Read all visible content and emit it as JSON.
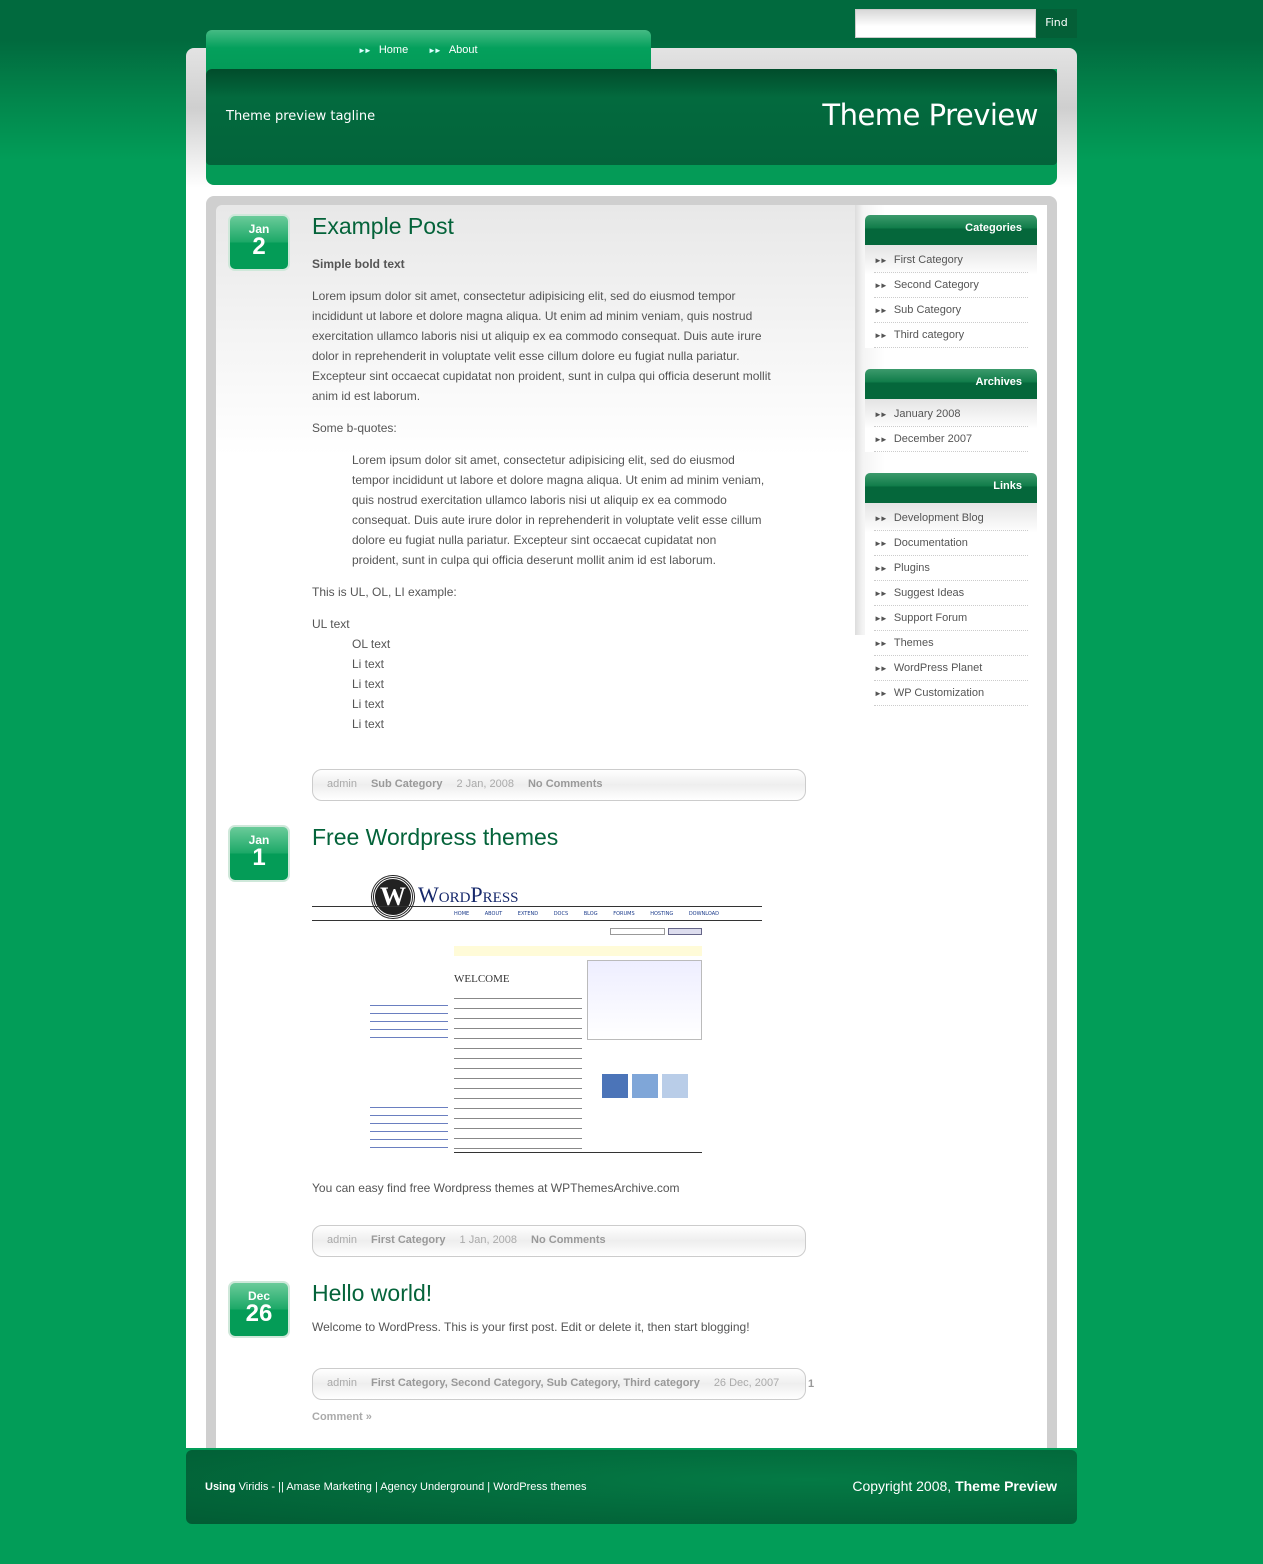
{
  "search": {
    "placeholder": "",
    "button": "Find"
  },
  "nav": [
    {
      "label": "Home"
    },
    {
      "label": "About"
    }
  ],
  "header": {
    "tagline": "Theme preview tagline",
    "title": "Theme Preview"
  },
  "posts": [
    {
      "month": "Jan",
      "day": "2",
      "title": "Example Post",
      "bold": "Simple bold text",
      "para": "Lorem ipsum dolor sit amet, consectetur adipisicing elit, sed do eiusmod tempor incididunt ut labore et dolore magna aliqua. Ut enim ad minim veniam, quis nostrud exercitation ullamco laboris nisi ut aliquip ex ea commodo consequat. Duis aute irure dolor in reprehenderit in voluptate velit esse cillum dolore eu fugiat nulla pariatur. Excepteur sint occaecat cupidatat non proident, sunt in culpa qui officia deserunt mollit anim id est laborum.",
      "bq_label": "Some b-quotes:",
      "blockquote": "Lorem ipsum dolor sit amet, consectetur adipisicing elit, sed do eiusmod tempor incididunt ut labore et dolore magna aliqua. Ut enim ad minim veniam, quis nostrud exercitation ullamco laboris nisi ut aliquip ex ea commodo consequat. Duis aute irure dolor in reprehenderit in voluptate velit esse cillum dolore eu fugiat nulla pariatur. Excepteur sint occaecat cupidatat non proident, sunt in culpa qui officia deserunt mollit anim id est laborum.",
      "list_label": "This is UL, OL, LI example:",
      "ul": "UL text",
      "ol": "OL text",
      "li": [
        "Li text",
        "Li text",
        "Li text",
        "Li text"
      ],
      "author": "admin",
      "category": "Sub Category",
      "date": "2 Jan, 2008",
      "comments": "No Comments"
    },
    {
      "month": "Jan",
      "day": "1",
      "title": "Free Wordpress themes",
      "text": "You can easy find free Wordpress themes at WPThemesArchive.com",
      "image": {
        "logo": "WordPress",
        "menu": [
          "HOME",
          "ABOUT",
          "EXTEND",
          "DOCS",
          "BLOG",
          "FORUMS",
          "HOSTING",
          "DOWNLOAD"
        ],
        "welcome": "WELCOME"
      },
      "author": "admin",
      "category": "First Category",
      "date": "1 Jan, 2008",
      "comments": "No Comments"
    },
    {
      "month": "Dec",
      "day": "26",
      "title": "Hello world!",
      "text": "Welcome to WordPress. This is your first post. Edit or delete it, then start blogging!",
      "author": "admin",
      "category": "First Category, Second Category, Sub Category, Third category",
      "date": "26 Dec, 2007",
      "comments_num": "1",
      "comments": "Comment »"
    }
  ],
  "sidebar": {
    "categories": {
      "title": "Categories",
      "items": [
        "First Category",
        "Second Category",
        "Sub Category",
        "Third category"
      ]
    },
    "archives": {
      "title": "Archives",
      "items": [
        "January 2008",
        "December 2007"
      ]
    },
    "links": {
      "title": "Links",
      "items": [
        "Development Blog",
        "Documentation",
        "Plugins",
        "Suggest Ideas",
        "Support Forum",
        "Themes",
        "WordPress Planet",
        "WP Customization"
      ]
    }
  },
  "footer": {
    "using": "Using",
    "links": "Viridis - || Amase Marketing | Agency Underground | WordPress themes",
    "copyright": "Copyright 2008,",
    "site": "Theme Preview"
  },
  "colors": {
    "accent": "#029d58",
    "dark": "#036a3e",
    "title": "#04633a"
  }
}
